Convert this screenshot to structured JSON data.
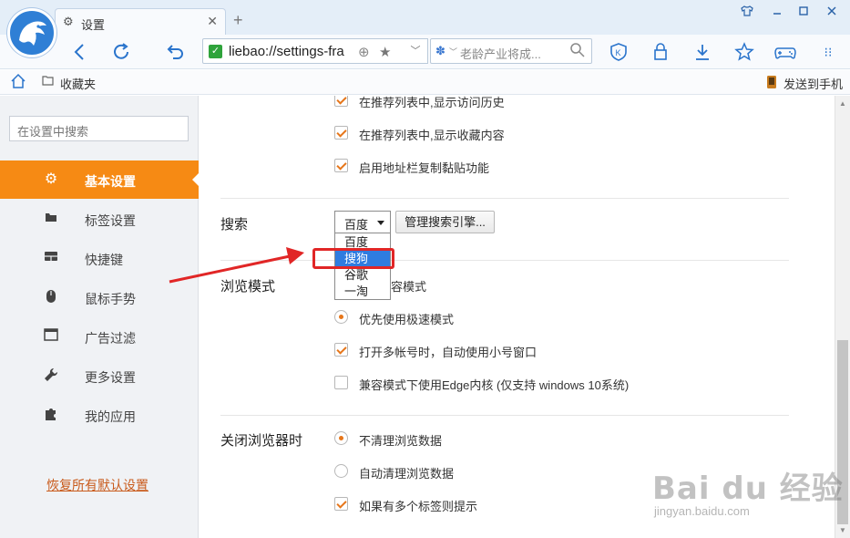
{
  "window": {
    "tab_title": "设置",
    "tab_icon": "gear-icon",
    "new_tab": "+",
    "controls": [
      "shirt-icon",
      "minimize-icon",
      "maximize-icon",
      "close-icon"
    ]
  },
  "toolbar": {
    "address": "liebao://settings-fra",
    "search_placeholder": "老龄产业将成...",
    "icons": [
      "back-icon",
      "refresh-icon",
      "undo-icon",
      "shield-k-icon",
      "lock-icon",
      "download-icon",
      "star-icon",
      "gamepad-icon",
      "more-icon"
    ]
  },
  "bookmarks": {
    "home_icon": "home-icon",
    "favorites": "收藏夹",
    "send_to_phone": "发送到手机"
  },
  "sidebar": {
    "search_placeholder": "在设置中搜索",
    "items": [
      {
        "label": "基本设置",
        "icon": "gear-icon",
        "active": true
      },
      {
        "label": "标签设置",
        "icon": "tab-icon",
        "active": false
      },
      {
        "label": "快捷键",
        "icon": "keyboard-icon",
        "active": false
      },
      {
        "label": "鼠标手势",
        "icon": "mouse-icon",
        "active": false
      },
      {
        "label": "广告过滤",
        "icon": "window-icon",
        "active": false
      },
      {
        "label": "更多设置",
        "icon": "wrench-icon",
        "active": false
      },
      {
        "label": "我的应用",
        "icon": "puzzle-icon",
        "active": false
      }
    ],
    "restore_defaults": "恢复所有默认设置"
  },
  "content": {
    "top_options": [
      {
        "label": "在推荐列表中,显示访问历史",
        "checked": true
      },
      {
        "label": "在推荐列表中,显示收藏内容",
        "checked": true
      },
      {
        "label": "启用地址栏复制黏贴功能",
        "checked": true
      }
    ],
    "search": {
      "section": "搜索",
      "selected": "百度",
      "manage_button": "管理搜索引擎...",
      "options": [
        "百度",
        "搜狗",
        "谷歌",
        "一淘"
      ],
      "highlighted": "搜狗"
    },
    "browse_mode": {
      "section": "浏览模式",
      "options": [
        {
          "label": "用兼容模式",
          "type": "radio",
          "on": false
        },
        {
          "label": "优先使用极速模式",
          "type": "radio",
          "on": true
        },
        {
          "label": "打开多帐号时，自动使用小号窗口",
          "type": "checkbox",
          "on": true
        },
        {
          "label": "兼容模式下使用Edge内核 (仅支持 windows 10系统)",
          "type": "checkbox",
          "on": false
        }
      ]
    },
    "on_close": {
      "section": "关闭浏览器时",
      "options": [
        {
          "label": "不清理浏览数据",
          "type": "radio",
          "on": true
        },
        {
          "label": "自动清理浏览数据",
          "type": "radio",
          "on": false
        },
        {
          "label": "如果有多个标签则提示",
          "type": "checkbox",
          "on": true
        }
      ]
    }
  },
  "watermark": {
    "main": "Bai du 经验",
    "sub": "jingyan.baidu.com"
  },
  "colors": {
    "accent": "#f68a14",
    "highlight": "#2f7ce0",
    "annotation": "#e12626",
    "link": "#c95b1c"
  }
}
